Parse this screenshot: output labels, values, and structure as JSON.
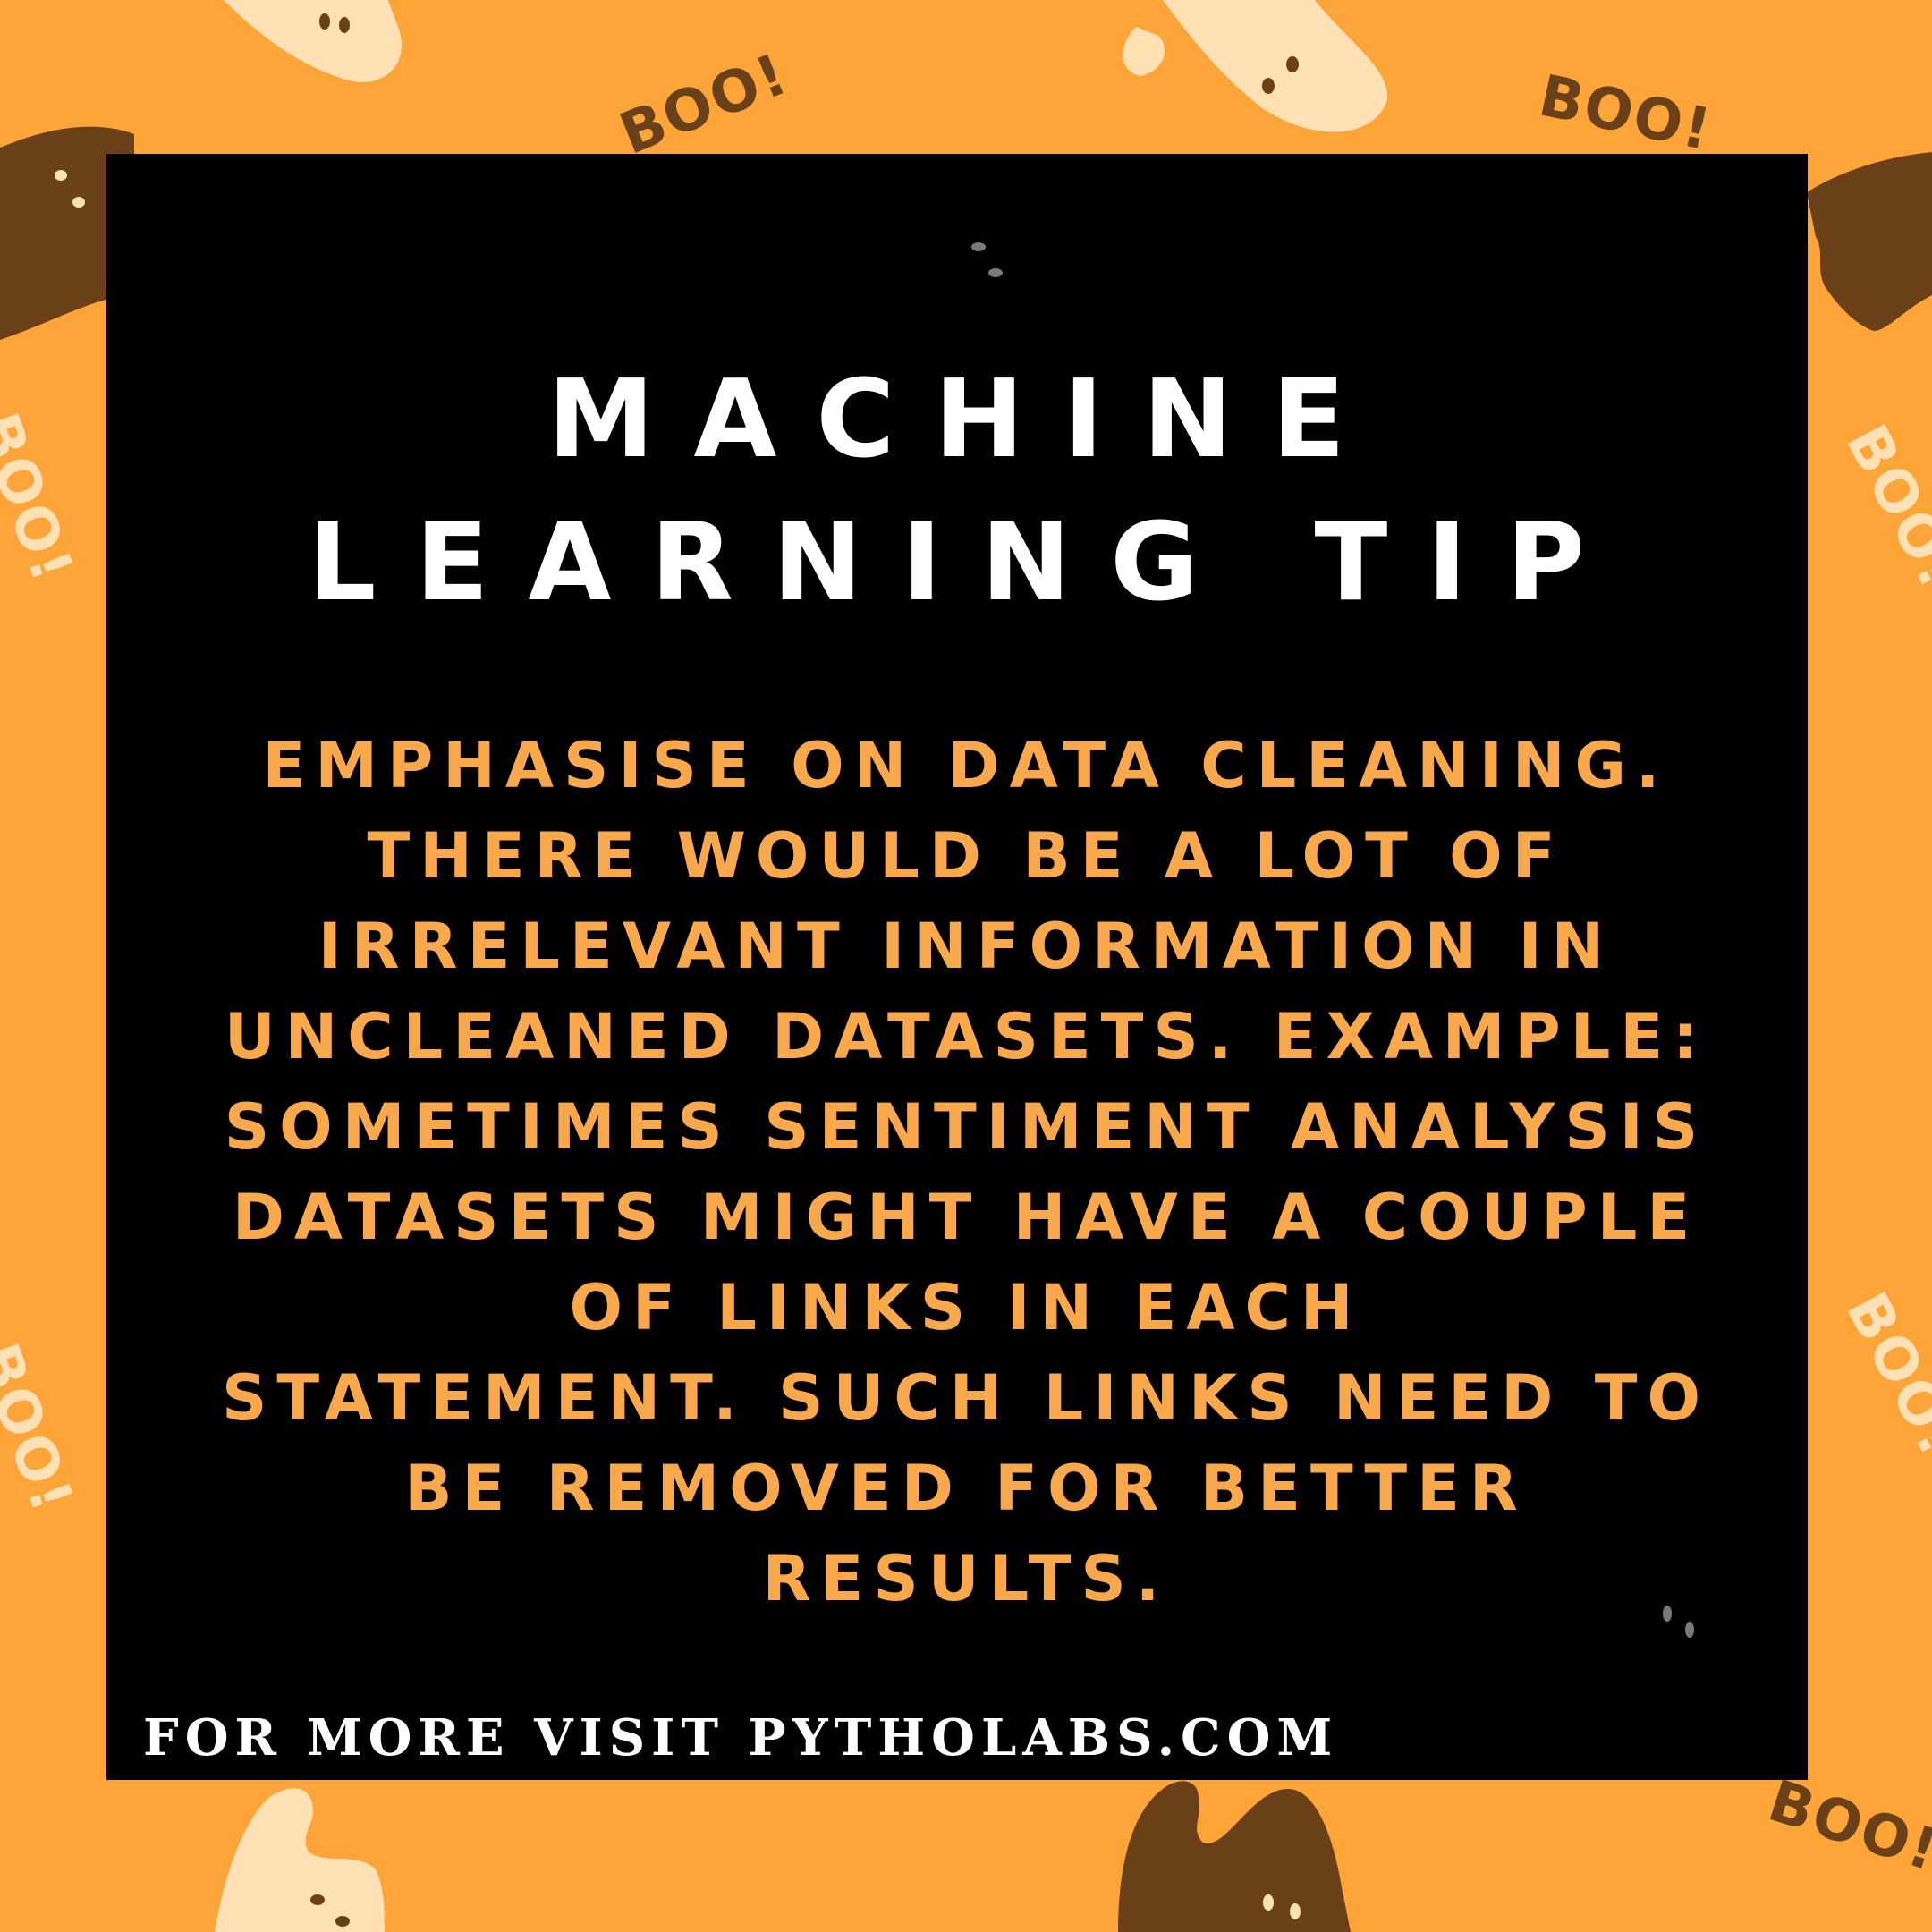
{
  "background": {
    "color": "#FEA53A",
    "ghost_dark": "#6A4019",
    "ghost_light": "#FFE1B5",
    "boo_stickers": [
      "BOO!",
      "BOO!",
      "BOO!",
      "BOO!",
      "BOO!",
      "BOO!",
      "BOO!"
    ]
  },
  "card": {
    "background": "#000000",
    "title_lines": [
      "MACHINE",
      "LEARNING TIP"
    ],
    "title_color": "#FFFFFF",
    "body_color": "#F9A84B",
    "body_lines": [
      "EMPHASISE ON DATA CLEANING.",
      "THERE WOULD BE A LOT OF",
      "IRRELEVANT INFORMATION IN",
      "UNCLEANED DATASETS. EXAMPLE:",
      "SOMETIMES SENTIMENT ANALYSIS",
      "DATASETS MIGHT HAVE A COUPLE",
      "OF LINKS IN EACH",
      "STATEMENT. SUCH LINKS NEED TO",
      "BE REMOVED FOR BETTER",
      "RESULTS."
    ],
    "footer": "FOR MORE VISIT PYTHOLABS.COM"
  }
}
